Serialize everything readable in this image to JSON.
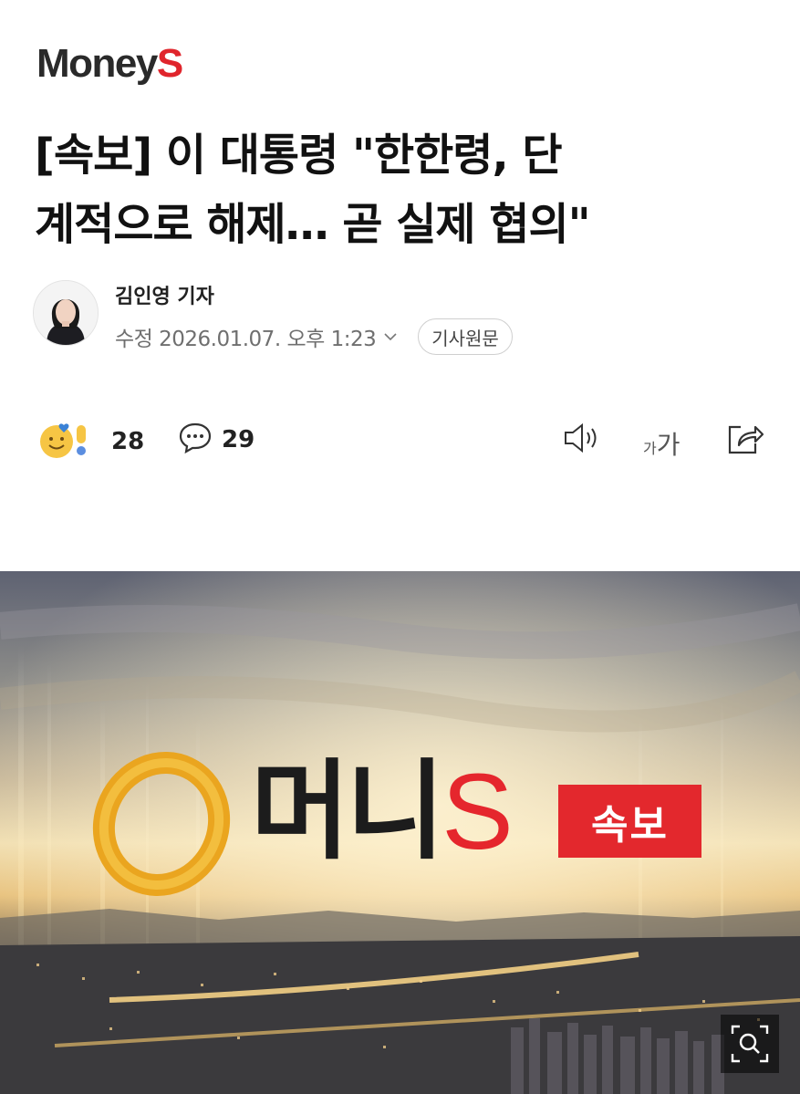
{
  "brand": {
    "name_main": "Money",
    "name_accent": "S"
  },
  "article": {
    "headline_line1": "[속보] 이 대통령 \"한한령, 단",
    "headline_line2": "계적으로 해제… 곧 실제 협의\"",
    "reporter": "김인영 기자",
    "updated": "수정 2026.01.07. 오후 1:23",
    "original_button": "기사원문"
  },
  "actions": {
    "reactions_count": "28",
    "comments_count": "29",
    "font_size_small": "가",
    "font_size_big": "가"
  },
  "hero": {
    "brand_text": "머니",
    "brand_accent": "S",
    "badge": "속보"
  },
  "colors": {
    "accent": "#e0252c",
    "badge": "#e3282d",
    "logo_gold": "#e9a520"
  },
  "icons": [
    "reaction-emoji-icon",
    "comment-bubble-icon",
    "speaker-icon",
    "share-icon",
    "zoom-icon",
    "chevron-down-icon"
  ]
}
